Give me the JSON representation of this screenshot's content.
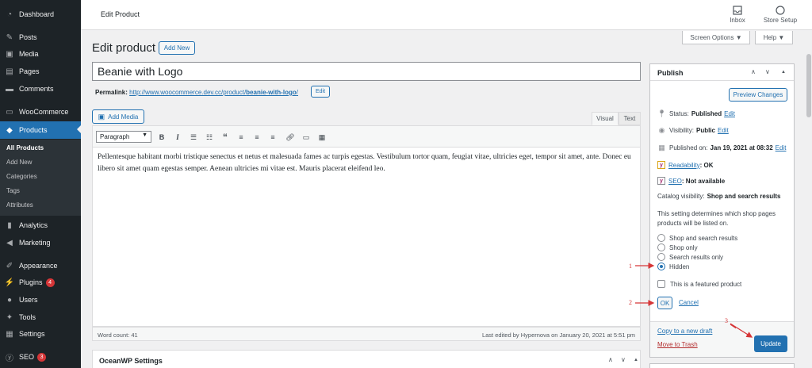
{
  "sidebar": {
    "items": [
      {
        "label": "Dashboard",
        "icon": "dashboard-icon"
      },
      {
        "label": "Posts",
        "icon": "pin-icon"
      },
      {
        "label": "Media",
        "icon": "media-icon"
      },
      {
        "label": "Pages",
        "icon": "page-icon"
      },
      {
        "label": "Comments",
        "icon": "comment-icon"
      },
      {
        "label": "WooCommerce",
        "icon": "woocommerce-icon"
      },
      {
        "label": "Products",
        "icon": "product-icon"
      },
      {
        "label": "Analytics",
        "icon": "analytics-icon"
      },
      {
        "label": "Marketing",
        "icon": "megaphone-icon"
      },
      {
        "label": "Appearance",
        "icon": "brush-icon"
      },
      {
        "label": "Plugins",
        "icon": "plugin-icon",
        "badge": "4"
      },
      {
        "label": "Users",
        "icon": "user-icon"
      },
      {
        "label": "Tools",
        "icon": "wrench-icon"
      },
      {
        "label": "Settings",
        "icon": "settings-icon"
      },
      {
        "label": "SEO",
        "icon": "yoast-icon",
        "badge": "3"
      }
    ],
    "submenu": [
      "All Products",
      "Add New",
      "Categories",
      "Tags",
      "Attributes"
    ]
  },
  "topbar": {
    "title": "Edit Product",
    "inbox": "Inbox",
    "store_setup": "Store Setup"
  },
  "screen_options": "Screen Options ▼",
  "help": "Help ▼",
  "main": {
    "heading": "Edit product",
    "add_new": "Add New",
    "title_value": "Beanie with Logo",
    "permalink_label": "Permalink:",
    "permalink_base": "http://www.woocommerce.dev.cc/product/",
    "permalink_slug": "beanie-with-logo",
    "permalink_end": "/",
    "permalink_edit": "Edit",
    "add_media": "Add Media",
    "tab_visual": "Visual",
    "tab_text": "Text",
    "format_select": "Paragraph",
    "content": "Pellentesque habitant morbi tristique senectus et netus et malesuada fames ac turpis egestas. Vestibulum tortor quam, feugiat vitae, ultricies eget, tempor sit amet, ante. Donec eu libero sit amet quam egestas semper. Aenean ultricies mi vitae est. Mauris placerat eleifend leo.",
    "word_count": "Word count: 41",
    "last_edited": "Last edited by Hypernova on January 20, 2021 at 5:51 pm",
    "ocean_title": "OceanWP Settings"
  },
  "publish": {
    "title": "Publish",
    "preview": "Preview Changes",
    "status_label": "Status:",
    "status_value": "Published",
    "visibility_label": "Visibility:",
    "visibility_value": "Public",
    "published_label": "Published on:",
    "published_value": "Jan 19, 2021 at 08:32",
    "edit": "Edit",
    "readability_label": "Readability",
    "readability_value": ": OK",
    "seo_label": "SEO",
    "seo_value": ": Not available",
    "catalog_label": "Catalog visibility:",
    "catalog_value": "Shop and search results",
    "catalog_desc": "This setting determines which shop pages products will be listed on.",
    "options": [
      "Shop and search results",
      "Shop only",
      "Search results only",
      "Hidden"
    ],
    "selected_option": "Hidden",
    "featured": "This is a featured product",
    "ok": "OK",
    "cancel": "Cancel",
    "copy_draft": "Copy to a new draft",
    "trash": "Move to Trash",
    "update": "Update"
  },
  "annotations": [
    "1",
    "2",
    "3"
  ],
  "colors": {
    "accent": "#2271b1",
    "sidebar": "#1d2327",
    "annotation": "#d63638"
  }
}
